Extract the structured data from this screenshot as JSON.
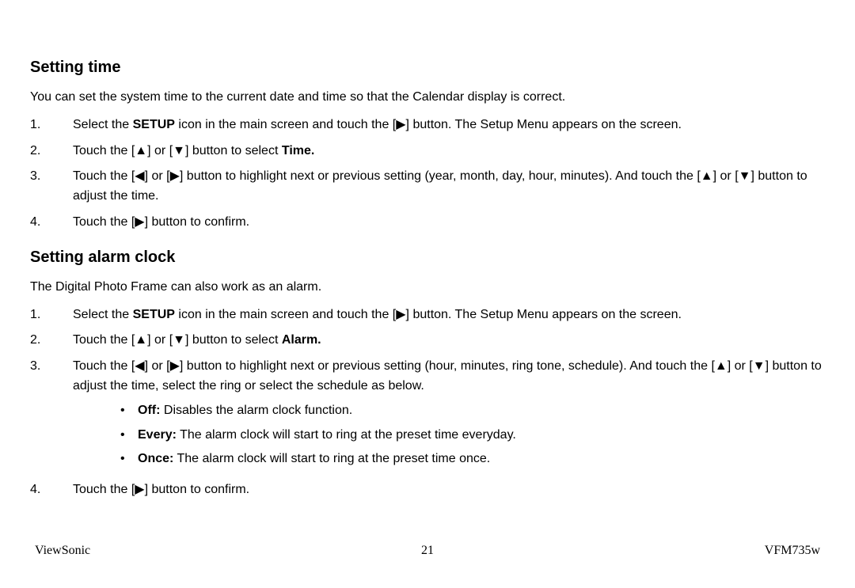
{
  "glyphs": {
    "right": "[▶]",
    "up": "[▲]",
    "down": "[▼]",
    "left": "[◀]"
  },
  "section1": {
    "heading": "Setting time",
    "intro": "You can set the system time to the current date and time so that the Calendar display is correct.",
    "steps": {
      "s1": {
        "num": "1.",
        "pre": "Select the ",
        "bold": "SETUP",
        "mid": " icon in the main screen and touch the ",
        "post": " button. The Setup Menu appears on the screen."
      },
      "s2": {
        "num": "2.",
        "pre": "Touch the ",
        "mid": " or ",
        "post": " button to select ",
        "bold": "Time."
      },
      "s3": {
        "num": "3.",
        "pre": "Touch the ",
        "mid1": " or ",
        "mid2": " button to highlight next or previous setting (year, month, day, hour, minutes). And touch the ",
        "mid3": " or ",
        "post": " button to adjust the time."
      },
      "s4": {
        "num": "4.",
        "pre": "Touch the ",
        "post": " button to confirm."
      }
    }
  },
  "section2": {
    "heading": "Setting alarm clock",
    "intro": "The Digital Photo Frame can also work as an alarm.",
    "steps": {
      "s1": {
        "num": "1.",
        "pre": "Select the ",
        "bold": "SETUP",
        "mid": " icon in the main screen and touch the ",
        "post": " button. The Setup Menu appears on the screen."
      },
      "s2": {
        "num": "2.",
        "pre": "Touch the ",
        "mid": " or ",
        "post": " button to select ",
        "bold": "Alarm."
      },
      "s3": {
        "num": "3.",
        "pre": "Touch the ",
        "mid1": " or ",
        "mid2": " button to highlight next or previous setting (hour, minutes, ring tone, schedule). And touch the ",
        "mid3": " or ",
        "post": " button to adjust the time, select the ring or select the schedule as below."
      },
      "bullets": {
        "b1": {
          "bold": "Off:",
          "text": " Disables the alarm clock function."
        },
        "b2": {
          "bold": "Every:",
          "text": " The alarm clock will start to ring at the preset time everyday."
        },
        "b3": {
          "bold": "Once:",
          "text": " The alarm clock will start to ring at the preset time once."
        }
      },
      "s4": {
        "num": "4.",
        "pre": "Touch the ",
        "post": " button to confirm."
      }
    }
  },
  "footer": {
    "left": "ViewSonic",
    "center": "21",
    "right": "VFM735w"
  }
}
